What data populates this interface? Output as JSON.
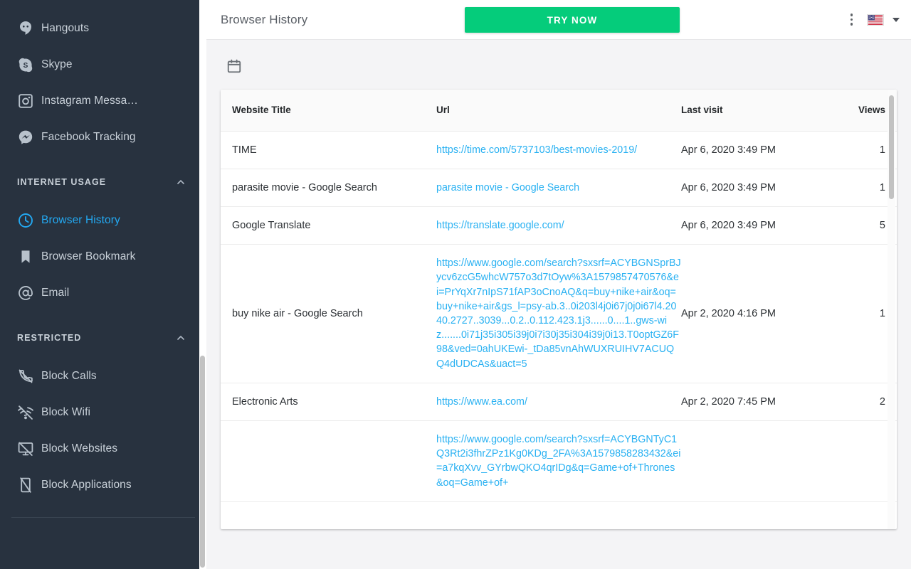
{
  "sidebar": {
    "apps": [
      {
        "label": "Hangouts",
        "icon": "hangouts-icon"
      },
      {
        "label": "Skype",
        "icon": "skype-icon"
      },
      {
        "label": "Instagram Messa…",
        "icon": "instagram-icon"
      },
      {
        "label": "Facebook Tracking",
        "icon": "messenger-icon"
      }
    ],
    "sections": [
      {
        "title": "INTERNET USAGE",
        "collapse_icon": "chevron-up-icon",
        "items": [
          {
            "label": "Browser History",
            "icon": "clock-icon",
            "active": true
          },
          {
            "label": "Browser Bookmark",
            "icon": "bookmark-icon",
            "active": false
          },
          {
            "label": "Email",
            "icon": "at-sign-icon",
            "active": false
          }
        ]
      },
      {
        "title": "RESTRICTED",
        "collapse_icon": "chevron-up-icon",
        "items": [
          {
            "label": "Block Calls",
            "icon": "phone-off-icon",
            "active": false
          },
          {
            "label": "Block Wifi",
            "icon": "wifi-off-icon",
            "active": false
          },
          {
            "label": "Block Websites",
            "icon": "monitor-off-icon",
            "active": false
          },
          {
            "label": "Block Applications",
            "icon": "smartphone-off-icon",
            "active": false
          }
        ]
      }
    ]
  },
  "topbar": {
    "title": "Browser History",
    "try_now_label": "TRY NOW",
    "menu_icon": "kebab-menu-icon",
    "flag_icon": "us-flag-icon",
    "caret_icon": "chevron-down-icon"
  },
  "toolbar": {
    "date_picker_icon": "calendar-icon"
  },
  "table": {
    "columns": [
      "Website Title",
      "Url",
      "Last visit",
      "Views"
    ],
    "rows": [
      {
        "title": "TIME",
        "url": "https://time.com/5737103/best-movies-2019/",
        "last_visit": "Apr 6, 2020 3:49 PM",
        "views": "1"
      },
      {
        "title": "parasite movie - Google Search",
        "url": "parasite movie - Google Search",
        "last_visit": "Apr 6, 2020 3:49 PM",
        "views": "1"
      },
      {
        "title": "Google Translate",
        "url": "https://translate.google.com/",
        "last_visit": "Apr 6, 2020 3:49 PM",
        "views": "5"
      },
      {
        "title": "buy nike air - Google Search",
        "url": "https://www.google.com/search?sxsrf=ACYBGNSprBJycv6zcG5whcW757o3d7tOyw%3A1579857470576&ei=PrYqXr7nIpS71fAP3oCnoAQ&q=buy+nike+air&oq=buy+nike+air&gs_l=psy-ab.3..0i203l4j0i67j0j0i67l4.2040.2727..3039...0.2..0.112.423.1j3......0....1..gws-wiz.......0i71j35i305i39j0i7i30j35i304i39j0i13.T0optGZ6F98&ved=0ahUKEwi-_tDa85vnAhWUXRUIHV7ACUQQ4dUDCAs&uact=5",
        "last_visit": "Apr 2, 2020 4:16 PM",
        "views": "1"
      },
      {
        "title": "Electronic Arts",
        "url": "https://www.ea.com/",
        "last_visit": "Apr 2, 2020 7:45 PM",
        "views": "2"
      },
      {
        "title": "",
        "url": "https://www.google.com/search?sxsrf=ACYBGNTyC1Q3Rt2i3fhrZPz1Kg0KDg_2FA%3A1579858283432&ei=a7kqXvv_GYrbwQKO4qrIDg&q=Game+of+Thrones&oq=Game+of+",
        "last_visit": "",
        "views": ""
      }
    ]
  },
  "colors": {
    "sidebar_bg": "#28323F",
    "accent_blue": "#23A9F2",
    "link_blue": "#29B1F2",
    "cta_green": "#05CC7B",
    "page_bg": "#f4f4f6"
  }
}
